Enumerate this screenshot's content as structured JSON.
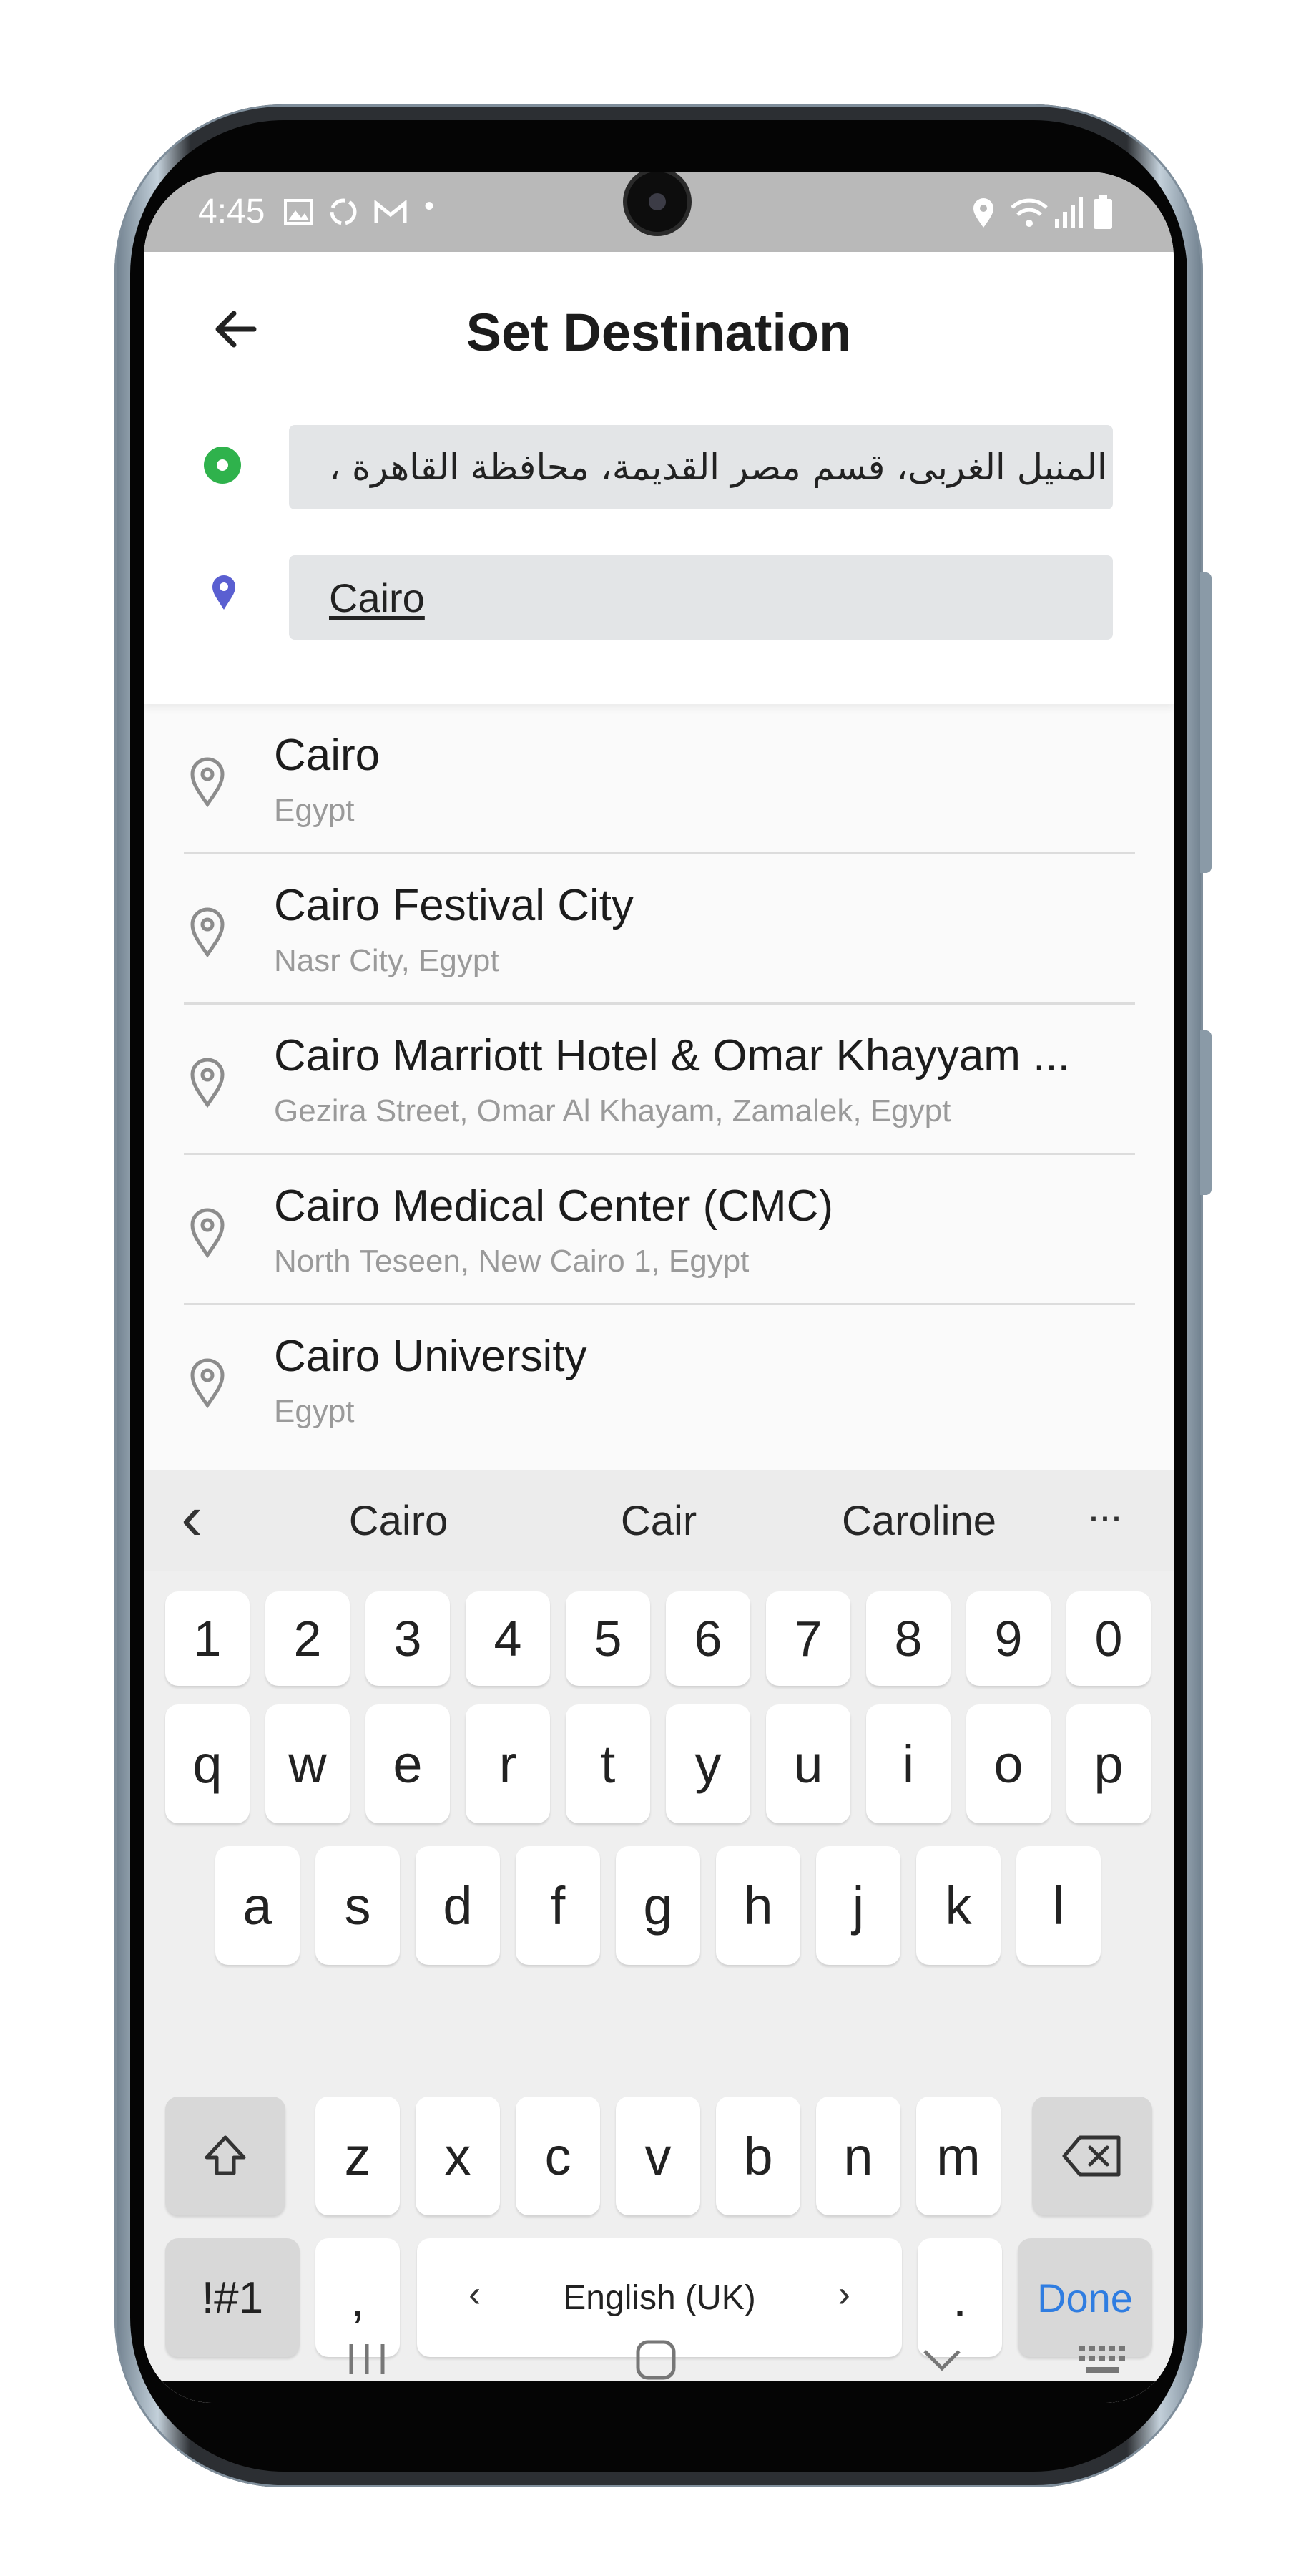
{
  "status_bar": {
    "time": "4:45",
    "left_icons": [
      "image-icon",
      "sync-icon",
      "gmail-icon",
      "dot-icon"
    ],
    "right_icons": [
      "location-icon",
      "wifi-icon",
      "signal-icon",
      "battery-icon"
    ]
  },
  "header": {
    "title": "Set Destination",
    "back_icon": "arrow-left-icon",
    "origin_value": "المنيل الغربى، قسم مصر القديمة، محافظة القاهرة ،",
    "destination_value": "Cairo",
    "origin_dot_color": "#2fb24c",
    "destination_pin_color": "#5a5fd1"
  },
  "results": [
    {
      "title": "Cairo",
      "subtitle": "Egypt"
    },
    {
      "title": "Cairo Festival City",
      "subtitle": "Nasr City, Egypt"
    },
    {
      "title": "Cairo Marriott Hotel & Omar Khayyam ...",
      "subtitle": "Gezira Street, Omar Al Khayam, Zamalek, Egypt"
    },
    {
      "title": "Cairo Medical Center (CMC)",
      "subtitle": "North Teseen, New Cairo 1, Egypt"
    },
    {
      "title": "Cairo University",
      "subtitle": "Egypt"
    }
  ],
  "keyboard": {
    "suggestions": [
      "Cairo",
      "Cair",
      "Caroline"
    ],
    "more_label": "···",
    "back_label": "‹",
    "number_row": [
      "1",
      "2",
      "3",
      "4",
      "5",
      "6",
      "7",
      "8",
      "9",
      "0"
    ],
    "row1": [
      "q",
      "w",
      "e",
      "r",
      "t",
      "y",
      "u",
      "i",
      "o",
      "p"
    ],
    "row2": [
      "a",
      "s",
      "d",
      "f",
      "g",
      "h",
      "j",
      "k",
      "l"
    ],
    "row3": [
      "z",
      "x",
      "c",
      "v",
      "b",
      "n",
      "m"
    ],
    "symbols_label": "!#1",
    "comma_label": ",",
    "space_label": "English (UK)",
    "space_left_arrow": "‹",
    "space_right_arrow": "›",
    "period_label": ".",
    "done_label": "Done"
  },
  "nav_bar": {
    "icons": [
      "recent-apps-icon",
      "home-icon",
      "back-icon",
      "keyboard-switch-icon"
    ]
  }
}
